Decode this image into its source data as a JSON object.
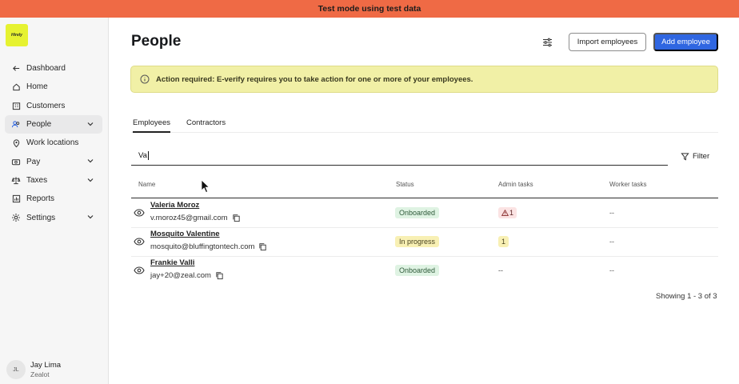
{
  "banner": {
    "text": "Test mode using test data"
  },
  "brand": {
    "logo_text": "Hirely"
  },
  "sidebar": {
    "items": [
      {
        "label": "Dashboard",
        "icon": "arrow-left-icon"
      },
      {
        "label": "Home",
        "icon": "home-icon"
      },
      {
        "label": "Customers",
        "icon": "building-icon"
      },
      {
        "label": "People",
        "icon": "people-icon",
        "active": true
      },
      {
        "label": "Work locations",
        "icon": "map-pin-icon"
      },
      {
        "label": "Pay",
        "icon": "money-icon"
      },
      {
        "label": "Taxes",
        "icon": "scale-icon"
      },
      {
        "label": "Reports",
        "icon": "chart-icon"
      },
      {
        "label": "Settings",
        "icon": "gear-icon"
      }
    ],
    "user": {
      "initials": "JL",
      "name": "Jay Lima",
      "role": "Zealot"
    }
  },
  "page": {
    "title": "People",
    "import_label": "Import employees",
    "add_label": "Add employee"
  },
  "alert": {
    "text": "Action required: E-verify requires you to take action for one or more of your employees."
  },
  "tabs": [
    {
      "label": "Employees",
      "active": true
    },
    {
      "label": "Contractors"
    }
  ],
  "search": {
    "value": "Va"
  },
  "filter": {
    "label": "Filter"
  },
  "table": {
    "columns": [
      "Name",
      "Status",
      "Admin tasks",
      "Worker tasks"
    ],
    "rows": [
      {
        "name": "Valeria Moroz",
        "email": "v.moroz45@gmail.com",
        "status": "Onboarded",
        "status_color": "#dff3e3",
        "admin_tasks": "1",
        "admin_warning": true,
        "worker_tasks": "--"
      },
      {
        "name": "Mosquito Valentine",
        "email": "mosquito@bluffingtontech.com",
        "status": "In progress",
        "status_color": "#f8f0b4",
        "admin_tasks": "1",
        "admin_warning": false,
        "worker_tasks": "--"
      },
      {
        "name": "Frankie Valli",
        "email": "jay+20@zeal.com",
        "status": "Onboarded",
        "status_color": "#dff3e3",
        "admin_tasks": "--",
        "admin_warning": false,
        "worker_tasks": "--"
      }
    ]
  },
  "pagination": {
    "text": "Showing 1 - 3 of 3"
  },
  "colors": {
    "banner": "#ef6a45",
    "primary": "#2f66e1",
    "logo": "#e6f231",
    "alert": "#f1f0a6"
  }
}
